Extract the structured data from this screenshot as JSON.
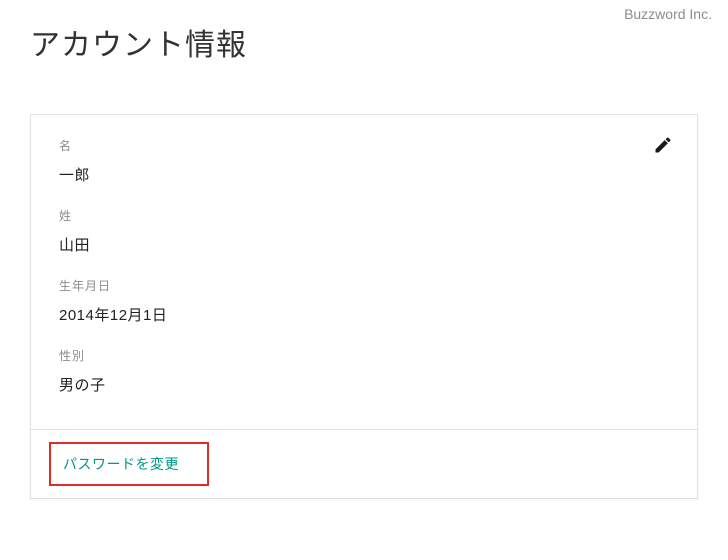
{
  "watermark": "Buzzword Inc.",
  "page": {
    "title": "アカウント情報"
  },
  "fields": {
    "firstName": {
      "label": "名",
      "value": "一郎"
    },
    "lastName": {
      "label": "姓",
      "value": "山田"
    },
    "birthDate": {
      "label": "生年月日",
      "value": "2014年12月1日"
    },
    "gender": {
      "label": "性別",
      "value": "男の子"
    }
  },
  "actions": {
    "changePassword": "パスワードを変更"
  }
}
